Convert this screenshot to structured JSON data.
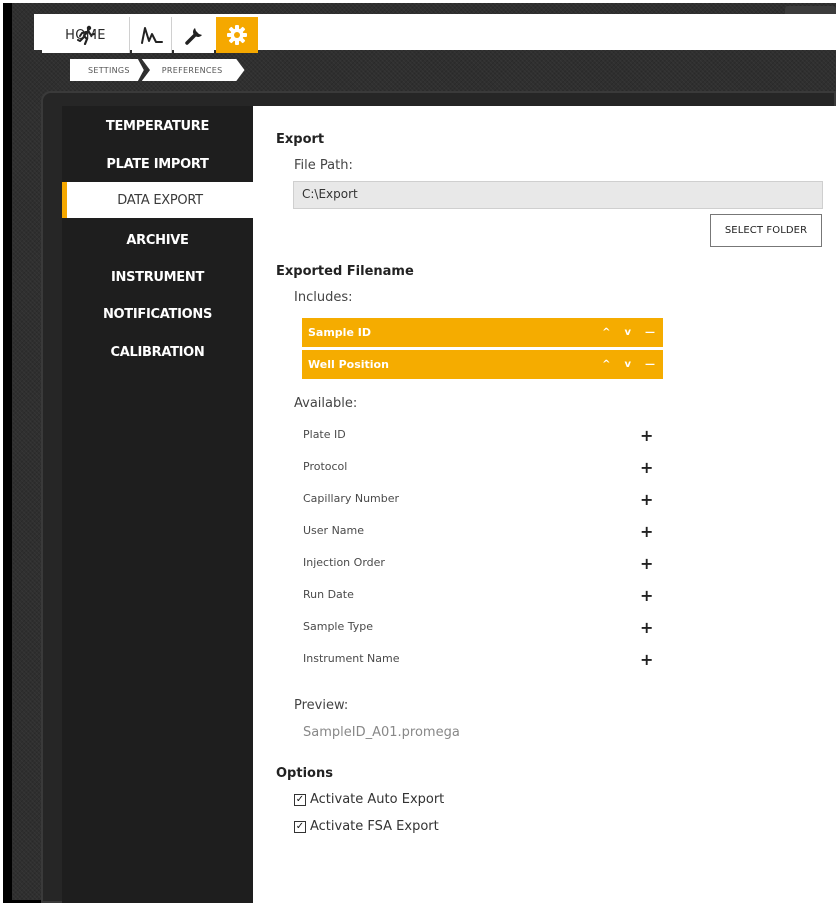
{
  "toolbar": {
    "home_label": "HOME",
    "tools": [
      "run-icon",
      "graph-icon",
      "wrench-icon",
      "gear-icon"
    ],
    "accent_color": "#f5a800"
  },
  "breadcrumb": {
    "settings": "SETTINGS",
    "preferences": "PREFERENCES"
  },
  "sidebar": {
    "items": [
      {
        "label": "TEMPERATURE",
        "active": false
      },
      {
        "label": "PLATE IMPORT",
        "active": false
      },
      {
        "label": "DATA EXPORT",
        "active": true
      },
      {
        "label": "ARCHIVE",
        "active": false
      },
      {
        "label": "INSTRUMENT",
        "active": false
      },
      {
        "label": "NOTIFICATIONS",
        "active": false
      },
      {
        "label": "CALIBRATION",
        "active": false
      }
    ]
  },
  "export": {
    "heading": "Export",
    "file_path_label": "File Path:",
    "file_path_value": "C:\\Export",
    "select_folder_label": "SELECT FOLDER"
  },
  "filename": {
    "heading": "Exported Filename",
    "includes_label": "Includes:",
    "includes": [
      {
        "label": "Sample ID"
      },
      {
        "label": "Well Position"
      }
    ],
    "available_label": "Available:",
    "available": [
      {
        "label": "Plate ID"
      },
      {
        "label": "Protocol"
      },
      {
        "label": "Capillary Number"
      },
      {
        "label": "User Name"
      },
      {
        "label": "Injection Order"
      },
      {
        "label": "Run Date"
      },
      {
        "label": "Sample Type"
      },
      {
        "label": "Instrument Name"
      }
    ],
    "preview_label": "Preview:",
    "preview_value": "SampleID_A01.promega"
  },
  "options": {
    "heading": "Options",
    "items": [
      {
        "label": "Activate Auto Export",
        "checked": true
      },
      {
        "label": "Activate FSA Export",
        "checked": true
      }
    ]
  },
  "glyphs": {
    "up": "^",
    "down": "v",
    "remove": "—",
    "add": "+",
    "check": "✓"
  }
}
